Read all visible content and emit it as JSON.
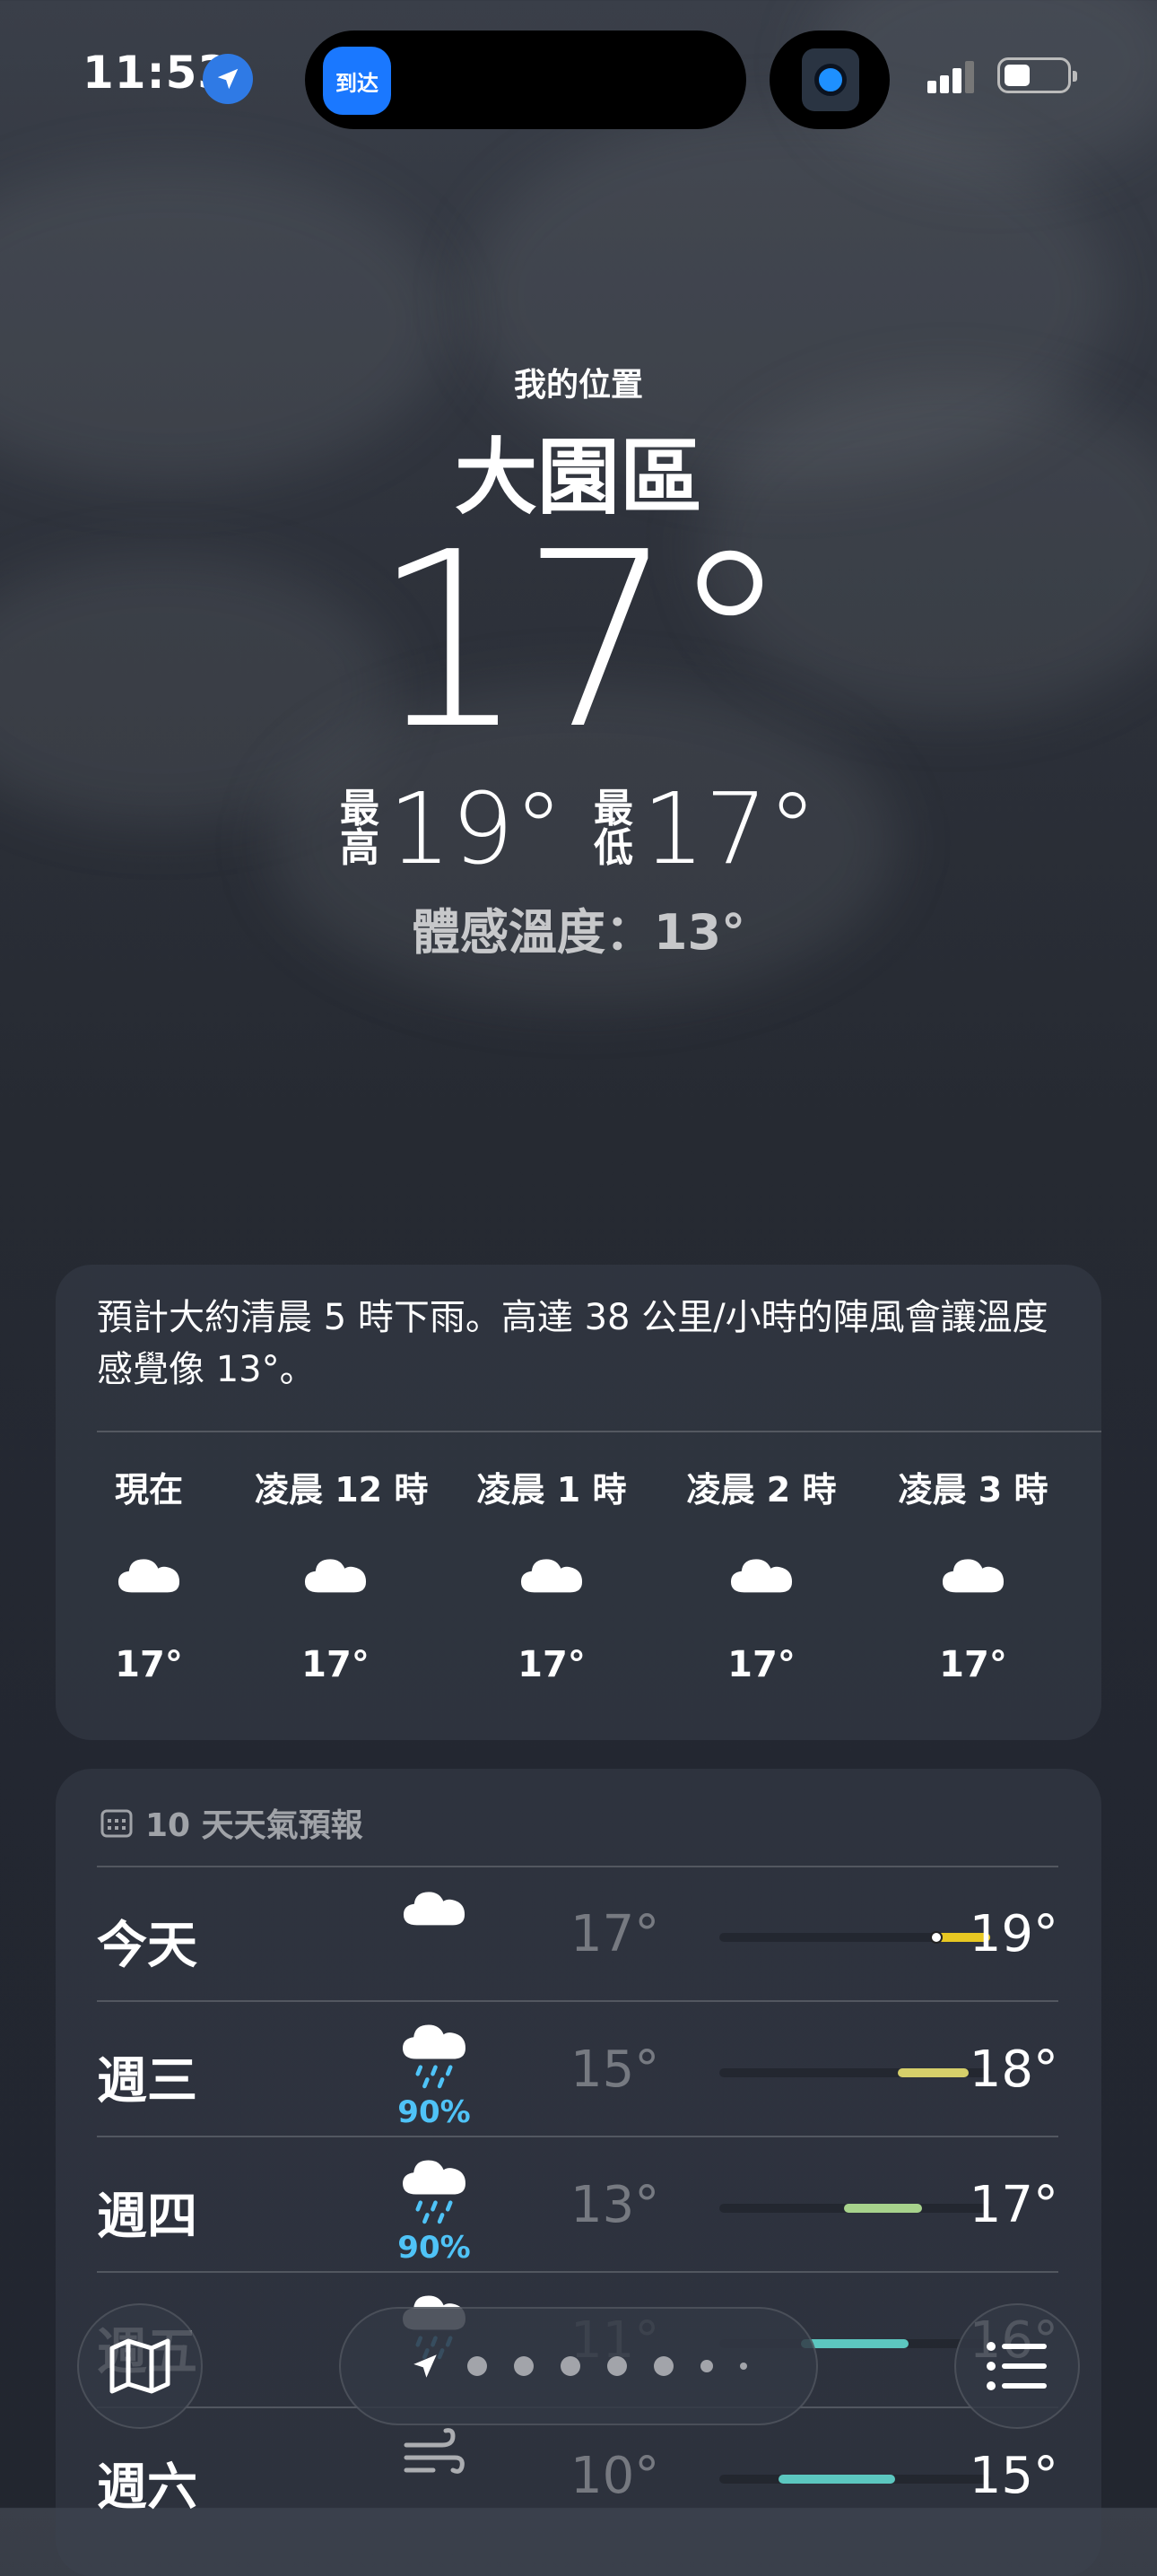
{
  "status_bar": {
    "time": "11:53",
    "island_badge": "到达"
  },
  "header": {
    "my_location": "我的位置",
    "city": "大園區",
    "temperature": "17°",
    "high_label": [
      "最",
      "高"
    ],
    "high": "19°",
    "low_label": [
      "最",
      "低"
    ],
    "low": "17°",
    "feels_like": "體感溫度：13°"
  },
  "hourly": {
    "summary": "預計大約清晨 5 時下雨。高達 38 公里/小時的陣風會讓溫度感覺像 13°。",
    "hours": [
      {
        "label": "現在",
        "icon": "cloud-icon",
        "temp": "17°"
      },
      {
        "label": "凌晨 12 時",
        "icon": "cloud-icon",
        "temp": "17°"
      },
      {
        "label": "凌晨 1 時",
        "icon": "cloud-icon",
        "temp": "17°"
      },
      {
        "label": "凌晨 2 時",
        "icon": "cloud-icon",
        "temp": "17°"
      },
      {
        "label": "凌晨 3 時",
        "icon": "cloud-icon",
        "temp": "17°"
      }
    ]
  },
  "daily": {
    "title": "10 天天氣預報",
    "days": [
      {
        "name": "今天",
        "icon": "cloud-icon",
        "precip": "",
        "low": "17°",
        "high": "19°",
        "bar_start": 0.8,
        "bar_end": 1.0,
        "bar_color": "#e8c822",
        "current": 0.8
      },
      {
        "name": "週三",
        "icon": "rain-cloud-icon",
        "precip": "90%",
        "low": "15°",
        "high": "18°",
        "bar_start": 0.66,
        "bar_end": 0.92,
        "bar_color": "#d6cf6a"
      },
      {
        "name": "週四",
        "icon": "rain-cloud-icon",
        "precip": "90%",
        "low": "13°",
        "high": "17°",
        "bar_start": 0.46,
        "bar_end": 0.75,
        "bar_color": "#a7d28c"
      },
      {
        "name": "週五",
        "icon": "rain-cloud-icon",
        "precip": "",
        "low": "11°",
        "high": "16°",
        "bar_start": 0.3,
        "bar_end": 0.7,
        "bar_color": "#5cc7c0"
      },
      {
        "name": "週六",
        "icon": "wind-icon",
        "precip": "",
        "low": "10°",
        "high": "15°",
        "bar_start": 0.22,
        "bar_end": 0.65,
        "bar_color": "#5cc7c0"
      }
    ]
  },
  "bottom_bar": {
    "left_icon": "map-icon",
    "right_icon": "list-icon",
    "page_count": 7
  }
}
